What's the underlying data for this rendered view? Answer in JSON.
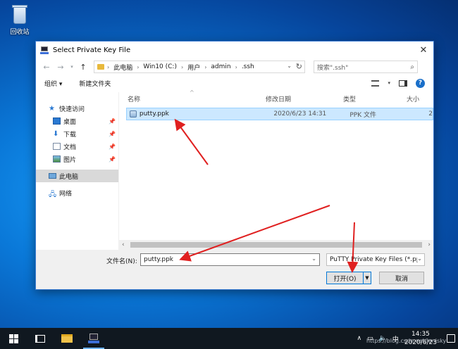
{
  "desktop": {
    "recycle_bin_label": "回收站"
  },
  "dialog": {
    "title": "Select Private Key File",
    "address": [
      "此电脑",
      "Win10 (C:)",
      "用户",
      "admin",
      ".ssh"
    ],
    "search_placeholder": "搜索\".ssh\"",
    "toolbar": {
      "organize": "组织 ▾",
      "new_folder": "新建文件夹"
    },
    "nav": {
      "quick_access": "快速访问",
      "desktop": "桌面",
      "downloads": "下载",
      "documents": "文档",
      "pictures": "图片",
      "this_pc": "此电脑",
      "network": "网络"
    },
    "columns": {
      "name": "名称",
      "modified": "修改日期",
      "type": "类型",
      "size": "大小"
    },
    "files": [
      {
        "name": "putty.ppk",
        "modified": "2020/6/23 14:31",
        "type": "PPK 文件",
        "size": "2"
      }
    ],
    "filename_label": "文件名(N):",
    "filename_value": "putty.ppk",
    "filter_value": "PuTTY Private Key Files (*.pp",
    "open_label": "打开(O)",
    "cancel_label": "取消"
  },
  "taskbar": {
    "time": "14:35",
    "date": "2020/6/23",
    "ime": "中"
  },
  "watermark": "https://blog.csdn.net/lenisky"
}
